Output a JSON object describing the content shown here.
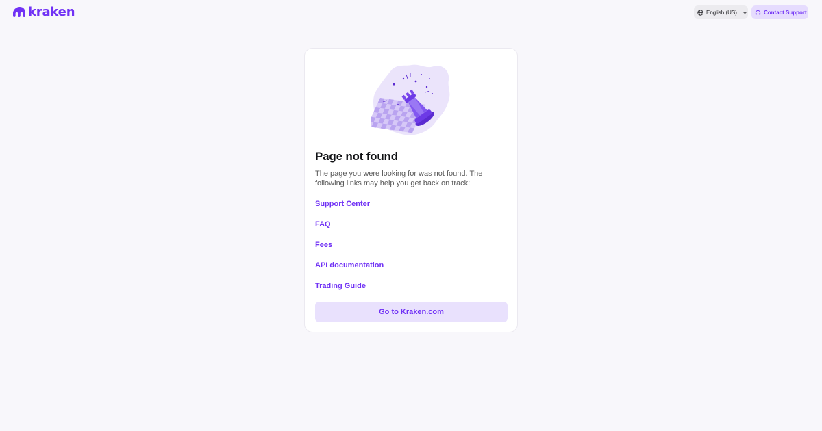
{
  "brand": {
    "name": "kraken",
    "color": "#7132f5"
  },
  "header": {
    "language_label": "English (US)",
    "contact_label": "Contact Support",
    "icons": [
      "globe-icon",
      "chevron-down-icon",
      "headset-icon"
    ]
  },
  "card": {
    "illustration": "chess-pawn-illustration",
    "title": "Page not found",
    "description": "The page you were looking for was not found. The following links may help you get back on track:",
    "links": [
      {
        "label": "Support Center"
      },
      {
        "label": "FAQ"
      },
      {
        "label": "Fees"
      },
      {
        "label": "API documentation"
      },
      {
        "label": "Trading Guide"
      }
    ],
    "cta_label": "Go to Kraken.com"
  }
}
